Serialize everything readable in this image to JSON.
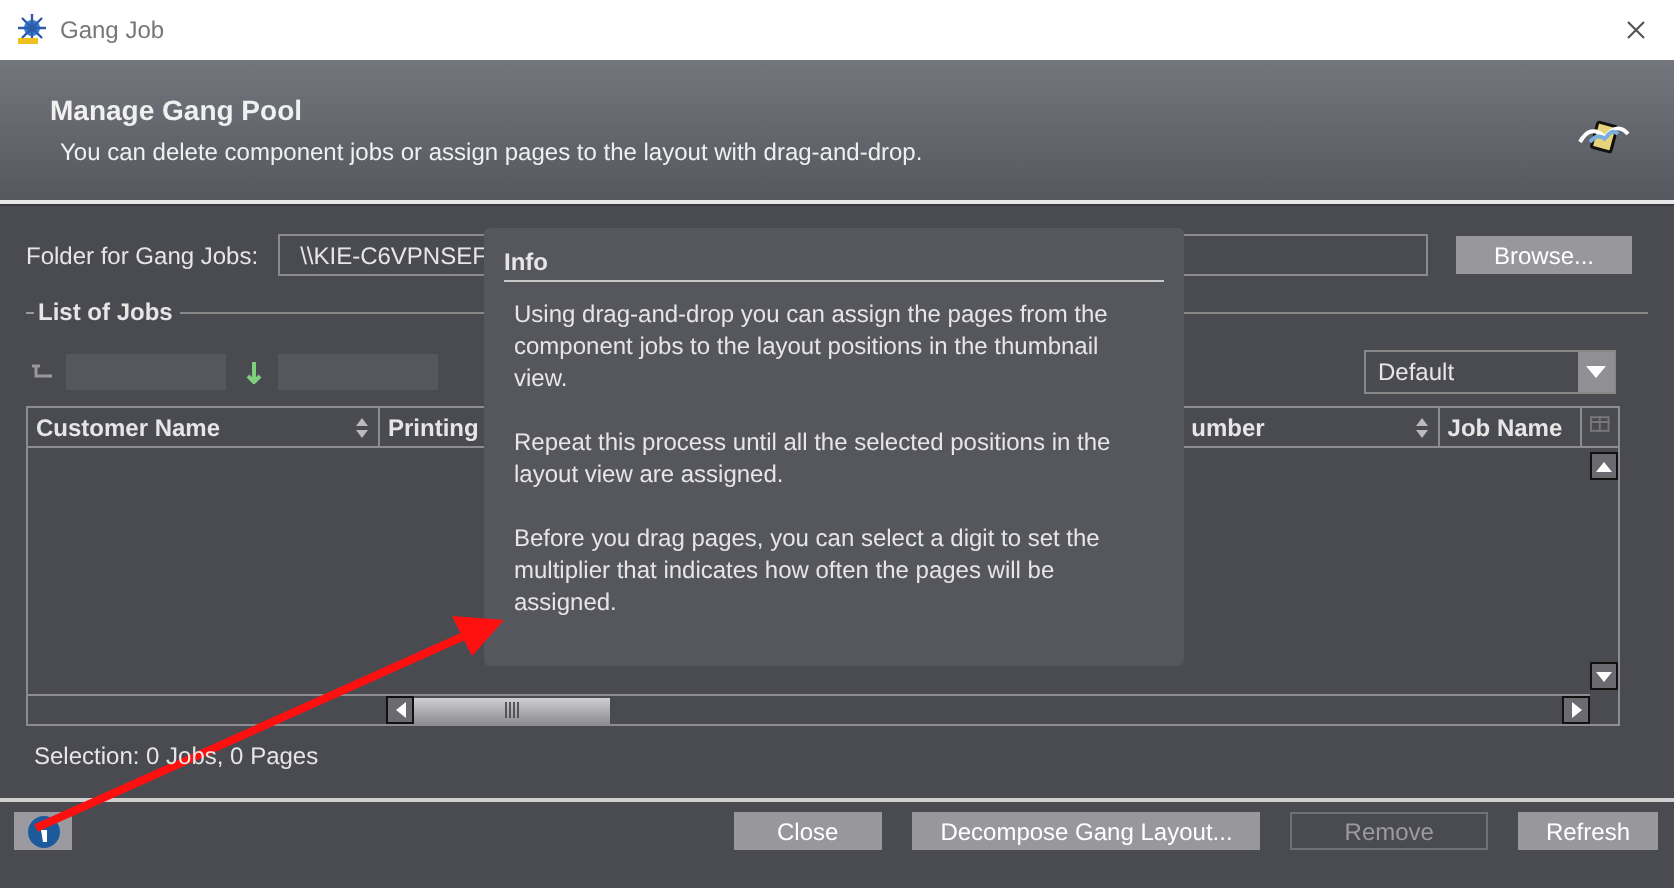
{
  "window": {
    "title": "Gang Job"
  },
  "header": {
    "title": "Manage Gang Pool",
    "subtitle": "You can delete component jobs or assign pages to the layout with drag-and-drop."
  },
  "folder": {
    "label": "Folder for Gang Jobs:",
    "value": "\\\\KIE-C6VPNSEF",
    "browse": "Browse..."
  },
  "list": {
    "title": "List of Jobs",
    "view": "Default",
    "columns": [
      {
        "label": "Customer Name",
        "sortable": true
      },
      {
        "label": "Printing",
        "sortable": false
      },
      {
        "label": "umber",
        "sortable": true
      },
      {
        "label": "Job Name",
        "sortable": false
      }
    ]
  },
  "selection": "Selection:  0 Jobs,  0 Pages",
  "info": {
    "title": "Info",
    "paragraphs": [
      "Using drag-and-drop you can assign the pages from the component jobs to the layout positions in the thumbnail view.",
      "Repeat this process until all the selected positions in the layout view are assigned.",
      "Before you drag pages, you can select a digit to set the multiplier that indicates how often the pages will be assigned."
    ]
  },
  "buttons": [
    {
      "label": "Close",
      "disabled": false
    },
    {
      "label": "Decompose Gang Layout...",
      "disabled": false
    },
    {
      "label": "Remove",
      "disabled": true
    },
    {
      "label": "Refresh",
      "disabled": false
    }
  ]
}
